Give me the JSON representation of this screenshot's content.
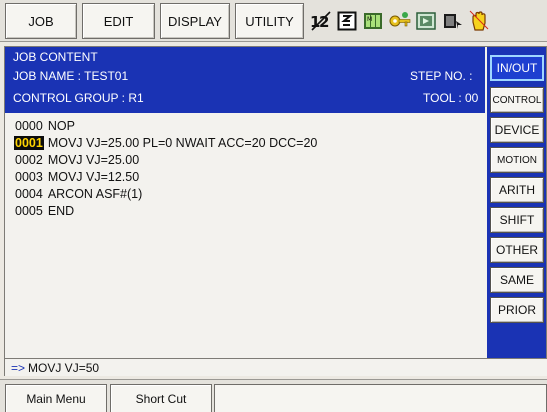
{
  "menu": {
    "job": "JOB",
    "edit": "EDIT",
    "display": "DISPLAY",
    "utility": "UTILITY"
  },
  "status_icons": [
    "control-group-icon",
    "coordinate-icon",
    "manual-speed-icon",
    "security-key-icon",
    "play-mode-icon",
    "page-icon",
    "servo-hand-icon"
  ],
  "job": {
    "header_title": "JOB CONTENT",
    "job_name": "JOB NAME : TEST01",
    "control_group": "CONTROL GROUP : R1",
    "step_no": "STEP NO. :",
    "tool": "TOOL : 00",
    "lines": [
      {
        "no": "0000",
        "cmd": "NOP"
      },
      {
        "no": "0001",
        "cmd": "MOVJ VJ=25.00  PL=0  NWAIT  ACC=20  DCC=20"
      },
      {
        "no": "0002",
        "cmd": "MOVJ VJ=25.00"
      },
      {
        "no": "0003",
        "cmd": "MOVJ VJ=12.50"
      },
      {
        "no": "0004",
        "cmd": "ARCON ASF#(1)"
      },
      {
        "no": "0005",
        "cmd": "END"
      }
    ],
    "cursor_line": "0001"
  },
  "side_menu": {
    "items": [
      {
        "label": "IN/OUT",
        "active": true
      },
      {
        "label": "CONTROL",
        "active": false
      },
      {
        "label": "DEVICE",
        "active": false
      },
      {
        "label": "MOTION",
        "active": false
      },
      {
        "label": "ARITH",
        "active": false
      },
      {
        "label": "SHIFT",
        "active": false
      },
      {
        "label": "OTHER",
        "active": false
      },
      {
        "label": "SAME",
        "active": false
      },
      {
        "label": "PRIOR",
        "active": false
      }
    ]
  },
  "input_buffer": {
    "arrow": "=>",
    "text": "MOVJ VJ=50"
  },
  "bottom": {
    "main_menu": "Main Menu",
    "short_cut": "Short Cut"
  },
  "colors": {
    "header_blue": "#1a33b4",
    "cursor_bg": "#0c0c0c",
    "cursor_text": "#ffd400",
    "active_button": "#1e3fd0"
  }
}
